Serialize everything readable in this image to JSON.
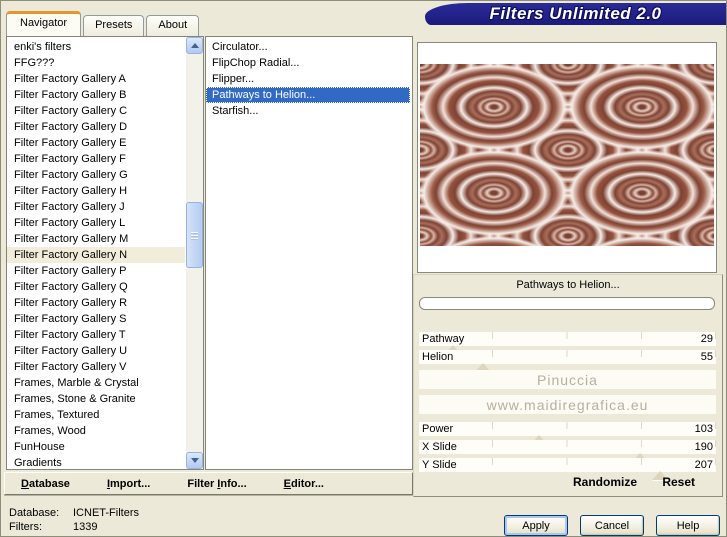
{
  "window": {
    "title": "Filters Unlimited 2.0"
  },
  "colors": {
    "window_bg": "#ece9d8",
    "banner_blue": "#22228c",
    "selection_blue": "#316ac5",
    "tab_accent_orange": "#e5962d",
    "pattern_brown_dark": "#7e4334",
    "pattern_brown_mid": "#9c5c48",
    "pattern_cream": "#f6ebe5"
  },
  "tabs": [
    {
      "label": "Navigator",
      "active": true
    },
    {
      "label": "Presets"
    },
    {
      "label": "About"
    }
  ],
  "category_list": {
    "items": [
      {
        "label": "enki's filters"
      },
      {
        "label": "FFG???"
      },
      {
        "label": "Filter Factory Gallery A"
      },
      {
        "label": "Filter Factory Gallery B"
      },
      {
        "label": "Filter Factory Gallery C"
      },
      {
        "label": "Filter Factory Gallery D"
      },
      {
        "label": "Filter Factory Gallery E"
      },
      {
        "label": "Filter Factory Gallery F"
      },
      {
        "label": "Filter Factory Gallery G"
      },
      {
        "label": "Filter Factory Gallery H"
      },
      {
        "label": "Filter Factory Gallery J"
      },
      {
        "label": "Filter Factory Gallery L"
      },
      {
        "label": "Filter Factory Gallery M"
      },
      {
        "label": "Filter Factory Gallery N",
        "highlight": true
      },
      {
        "label": "Filter Factory Gallery P"
      },
      {
        "label": "Filter Factory Gallery Q"
      },
      {
        "label": "Filter Factory Gallery R"
      },
      {
        "label": "Filter Factory Gallery S"
      },
      {
        "label": "Filter Factory Gallery T"
      },
      {
        "label": "Filter Factory Gallery U"
      },
      {
        "label": "Filter Factory Gallery V"
      },
      {
        "label": "Frames, Marble & Crystal"
      },
      {
        "label": "Frames, Stone & Granite"
      },
      {
        "label": "Frames, Textured"
      },
      {
        "label": "Frames, Wood"
      },
      {
        "label": "FunHouse"
      },
      {
        "label": "Gradients"
      }
    ]
  },
  "filter_list": {
    "items": [
      {
        "label": "Circulator..."
      },
      {
        "label": "FlipChop Radial..."
      },
      {
        "label": "Flipper..."
      },
      {
        "label": "Pathways to Helion...",
        "selected": true
      },
      {
        "label": "Starfish..."
      }
    ]
  },
  "preview": {
    "filter_name": "Pathways to Helion...",
    "progress_percent": 0
  },
  "watermark": {
    "line1": "Pinuccia",
    "line2": "www.maidiregrafica.eu"
  },
  "sliders_top": [
    {
      "label": "Pathway",
      "value": 29,
      "max": 255
    },
    {
      "label": "Helion",
      "value": 55,
      "max": 255
    }
  ],
  "sliders_bottom": [
    {
      "label": "Power",
      "value": 103,
      "max": 255
    },
    {
      "label": "X Slide",
      "value": 190,
      "max": 255
    },
    {
      "label": "Y Slide",
      "value": 207,
      "max": 255
    }
  ],
  "actions": {
    "randomize": "Randomize",
    "reset": "Reset"
  },
  "toolbar": {
    "items": [
      {
        "pre": "",
        "key": "D",
        "post": "atabase"
      },
      {
        "pre": "",
        "key": "I",
        "post": "mport..."
      },
      {
        "pre": "Filter ",
        "key": "I",
        "post": "nfo..."
      },
      {
        "pre": "",
        "key": "E",
        "post": "ditor..."
      }
    ]
  },
  "status": {
    "rows": [
      {
        "label": "Database:",
        "value": "ICNET-Filters"
      },
      {
        "label": "Filters:",
        "value": "1339"
      }
    ]
  },
  "buttons": [
    {
      "label": "Apply",
      "default": true
    },
    {
      "label": "Cancel"
    },
    {
      "label": "Help"
    }
  ],
  "icons": {
    "scroll_up": "chevron-up",
    "scroll_down": "chevron-down",
    "slider_thumb": "triangle-up"
  }
}
